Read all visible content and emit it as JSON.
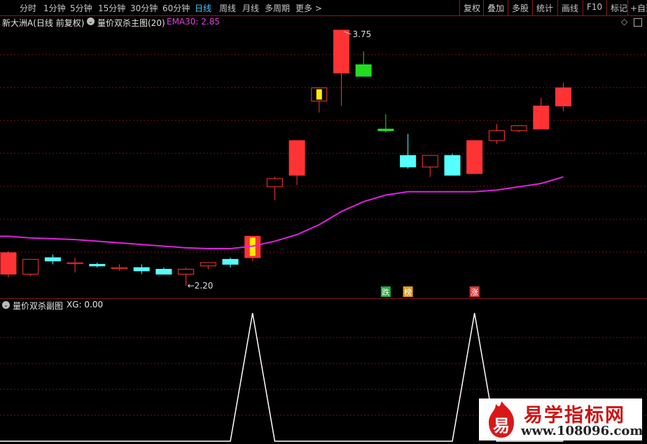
{
  "toolbar": {
    "periods": [
      "分时",
      "1分钟",
      "5分钟",
      "15分钟",
      "30分钟",
      "60分钟",
      "日线",
      "周线",
      "月线",
      "多周期",
      "更多 >"
    ],
    "active_period": "日线",
    "tools": [
      "复权",
      "叠加",
      "多股",
      "统计",
      "画线",
      "F10",
      "标记",
      "+自选"
    ]
  },
  "main_header": {
    "stock_label": "新大洲A(日线 前复权)",
    "indicator_name": "量价双杀主图(20)",
    "ema_label": "EMA30: 2.85"
  },
  "sub_header": {
    "indicator_name": "量价双杀副图",
    "xg_label": "XG: 0.00"
  },
  "price_chart": {
    "high_label": "3.75",
    "low_label": "2.20",
    "markers": [
      {
        "text": "跌",
        "candle": 17,
        "color": "#1fae3b"
      },
      {
        "text": "榜",
        "candle": 18,
        "color": "#d8a020"
      },
      {
        "text": "涨",
        "candle": 21,
        "color": "#d23a3a"
      }
    ],
    "candles": [
      {
        "o": 2.27,
        "c": 2.4,
        "h": 2.41,
        "l": 2.25
      },
      {
        "o": 2.27,
        "c": 2.36,
        "h": 2.36,
        "l": 2.26
      },
      {
        "o": 2.37,
        "c": 2.35,
        "h": 2.39,
        "l": 2.33
      },
      {
        "o": 2.34,
        "c": 2.34,
        "h": 2.37,
        "l": 2.28
      },
      {
        "o": 2.33,
        "c": 2.32,
        "h": 2.34,
        "l": 2.31
      },
      {
        "o": 2.31,
        "c": 2.31,
        "h": 2.33,
        "l": 2.29
      },
      {
        "o": 2.31,
        "c": 2.29,
        "h": 2.33,
        "l": 2.27
      },
      {
        "o": 2.3,
        "c": 2.27,
        "h": 2.31,
        "l": 2.27
      },
      {
        "o": 2.27,
        "c": 2.3,
        "h": 2.31,
        "l": 2.2
      },
      {
        "o": 2.32,
        "c": 2.34,
        "h": 2.34,
        "l": 2.3
      },
      {
        "o": 2.36,
        "c": 2.33,
        "h": 2.37,
        "l": 2.31
      },
      {
        "o": 2.37,
        "c": 2.5,
        "h": 2.5,
        "l": 2.35
      },
      {
        "o": 2.8,
        "c": 2.85,
        "h": 2.86,
        "l": 2.72
      },
      {
        "o": 2.87,
        "c": 3.08,
        "h": 3.08,
        "l": 2.81
      },
      {
        "o": 3.32,
        "c": 3.4,
        "h": 3.4,
        "l": 3.25
      },
      {
        "o": 3.49,
        "c": 3.75,
        "h": 3.75,
        "l": 3.29
      },
      {
        "o": 3.54,
        "c": 3.47,
        "h": 3.62,
        "l": 3.47
      },
      {
        "o": 3.15,
        "c": 3.14,
        "h": 3.24,
        "l": 3.13
      },
      {
        "o": 2.99,
        "c": 2.92,
        "h": 3.12,
        "l": 2.91
      },
      {
        "o": 2.92,
        "c": 2.99,
        "h": 2.99,
        "l": 2.86
      },
      {
        "o": 2.99,
        "c": 2.87,
        "h": 3.0,
        "l": 2.87
      },
      {
        "o": 2.88,
        "c": 3.08,
        "h": 3.08,
        "l": 2.88
      },
      {
        "o": 3.08,
        "c": 3.14,
        "h": 3.18,
        "l": 3.06
      },
      {
        "o": 3.14,
        "c": 3.17,
        "h": 3.17,
        "l": 3.13
      },
      {
        "o": 3.15,
        "c": 3.29,
        "h": 3.34,
        "l": 3.15
      },
      {
        "o": 3.29,
        "c": 3.4,
        "h": 3.43,
        "l": 3.26
      }
    ],
    "ema30": [
      2.5,
      2.49,
      2.485,
      2.48,
      2.47,
      2.46,
      2.45,
      2.44,
      2.43,
      2.425,
      2.425,
      2.44,
      2.47,
      2.51,
      2.57,
      2.65,
      2.71,
      2.75,
      2.77,
      2.77,
      2.77,
      2.77,
      2.78,
      2.8,
      2.82,
      2.86
    ]
  },
  "sub_chart": {
    "xg_values": [
      0,
      0,
      0,
      0,
      0,
      0,
      0,
      0,
      0,
      0,
      0,
      1,
      0,
      0,
      0,
      0,
      0,
      0,
      0,
      0,
      0,
      1,
      0,
      0,
      0,
      0
    ]
  },
  "watermark": {
    "logo_char": "易",
    "title": "易学指标网",
    "url": "www.108096.com"
  },
  "colors": {
    "up": "#ff3333",
    "down": "#55ffff",
    "ema": "#e020e0",
    "xg": "#ffffff",
    "grid": "#7a1010"
  }
}
